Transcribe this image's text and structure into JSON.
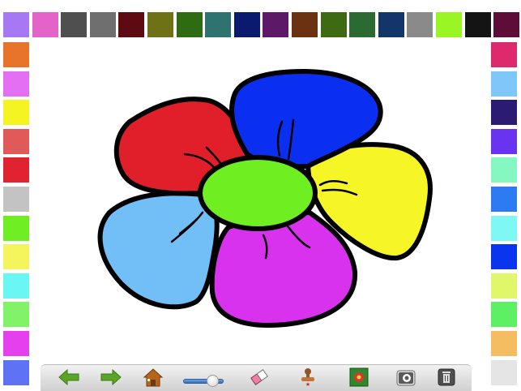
{
  "palette": {
    "top": [
      "#a678f4",
      "#e463c8",
      "#4f4f4f",
      "#6f6f6f",
      "#5e0a13",
      "#6f7116",
      "#2f6b12",
      "#2e7370",
      "#0a1a6e",
      "#5e1868",
      "#6a3211",
      "#3d6a12",
      "#2b6a33",
      "#12356a",
      "#8a8a8a",
      "#99f524",
      "#141414",
      "#5e0c38"
    ],
    "left": [
      "#e8732b",
      "#e56ff2",
      "#f4f423",
      "#e05a5a",
      "#e02231",
      "#c3c3c3",
      "#6fee24",
      "#f4f45c",
      "#6af7f4",
      "#82f268",
      "#e540ee",
      "#5e73f4"
    ],
    "right": [
      "#de2a6d",
      "#7fc6f9",
      "#2c1b72",
      "#6a33f0",
      "#85f7c1",
      "#2c7bf3",
      "#7ff7f4",
      "#0b34ee",
      "#dff768",
      "#5ef064",
      "#f4bd62",
      "#e5e5e5"
    ]
  },
  "drawing": {
    "subject": "flower",
    "colors": {
      "petal_top": "#0a2ff0",
      "petal_left": "#e01f2b",
      "petal_right": "#f6f525",
      "petal_bottom_left": "#72bef6",
      "petal_bottom": "#d932ef",
      "center": "#6fef22",
      "outline": "#000000"
    }
  },
  "toolbar": {
    "back_icon": "arrow-left-icon",
    "forward_icon": "arrow-right-icon",
    "home_icon": "home-icon",
    "brush_size_level": 0.72,
    "eraser_icon": "eraser-icon",
    "stamp_icon": "stamp-icon",
    "picture_icon": "flower-picture-icon",
    "camera_icon": "camera-icon",
    "trash_icon": "trash-icon",
    "accent": "#5aa526"
  }
}
